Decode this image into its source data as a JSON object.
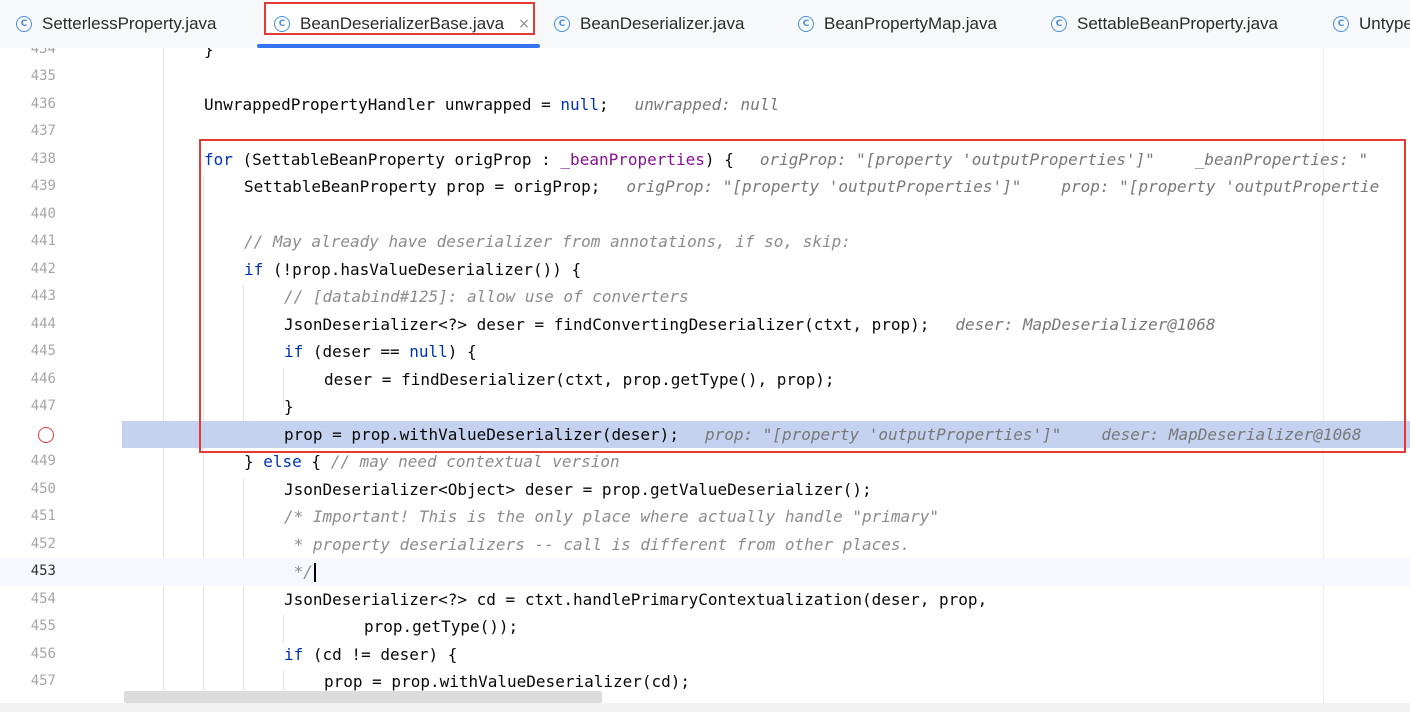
{
  "tabs": [
    {
      "label": "SetterlessProperty.java",
      "icon": "class-icon"
    },
    {
      "label": "BeanDeserializerBase.java",
      "icon": "class-icon",
      "active": true
    },
    {
      "label": "BeanDeserializer.java",
      "icon": "class-icon"
    },
    {
      "label": "BeanPropertyMap.java",
      "icon": "class-icon"
    },
    {
      "label": "SettableBeanProperty.java",
      "icon": "class-icon"
    },
    {
      "label": "Untype",
      "icon": "class-icon"
    }
  ],
  "tab_icon_glyph": "C",
  "tab_close_glyph": "×",
  "editor": {
    "current_line": "453",
    "breakpoint_line": "448",
    "lines": [
      {
        "n": "434",
        "t": "}"
      },
      {
        "n": "435",
        "t": ""
      },
      {
        "n": "436",
        "a": "UnwrappedPropertyHandler unwrapped = ",
        "k": "null",
        "b": ";",
        "h": "unwrapped: null"
      },
      {
        "n": "437",
        "t": ""
      },
      {
        "n": "438",
        "k": "for",
        "a": " (SettableBeanProperty origProp : ",
        "f": "_beanProperties",
        "b": ") {",
        "h": "origProp: \"[property 'outputProperties']\"",
        "h2": "_beanProperties: \""
      },
      {
        "n": "439",
        "a": "SettableBeanProperty prop = origProp;",
        "h": "origProp: \"[property 'outputProperties']\"",
        "h2": "prop: \"[property 'outputPropertie"
      },
      {
        "n": "440",
        "t": ""
      },
      {
        "n": "441",
        "c": "// May already have deserializer from annotations, if so, skip:"
      },
      {
        "n": "442",
        "k": "if",
        "a": " (!prop.hasValueDeserializer()) {"
      },
      {
        "n": "443",
        "c": "// [databind#125]: allow use of converters"
      },
      {
        "n": "444",
        "a": "JsonDeserializer<?> deser = findConvertingDeserializer(ctxt, prop);",
        "h": "deser: MapDeserializer@1068"
      },
      {
        "n": "445",
        "k": "if",
        "a": " (deser == ",
        "k2": "null",
        "b": ") {"
      },
      {
        "n": "446",
        "a": "deser = findDeserializer(ctxt, prop.getType(), prop);"
      },
      {
        "n": "447",
        "a": "}"
      },
      {
        "n": "448",
        "a": "prop = prop.withValueDeserializer(deser);",
        "h": "prop: \"[property 'outputProperties']\"",
        "h2": "deser: MapDeserializer@1068"
      },
      {
        "n": "449",
        "a": "} ",
        "k": "else",
        "b": " { ",
        "c": "// may need contextual version"
      },
      {
        "n": "450",
        "a": "JsonDeserializer<Object> deser = prop.getValueDeserializer();"
      },
      {
        "n": "451",
        "c": "/* Important! This is the only place where actually handle \"primary\""
      },
      {
        "n": "452",
        "c": " * property deserializers -- call is different from other places."
      },
      {
        "n": "453",
        "c": " */"
      },
      {
        "n": "454",
        "a": "JsonDeserializer<?> cd = ctxt.handlePrimaryContextualization(deser, prop,"
      },
      {
        "n": "455",
        "a": "prop.getType());"
      },
      {
        "n": "456",
        "k": "if",
        "a": " (cd != deser) {"
      },
      {
        "n": "457",
        "a": "prop = prop.withValueDeserializer(cd);"
      }
    ]
  }
}
